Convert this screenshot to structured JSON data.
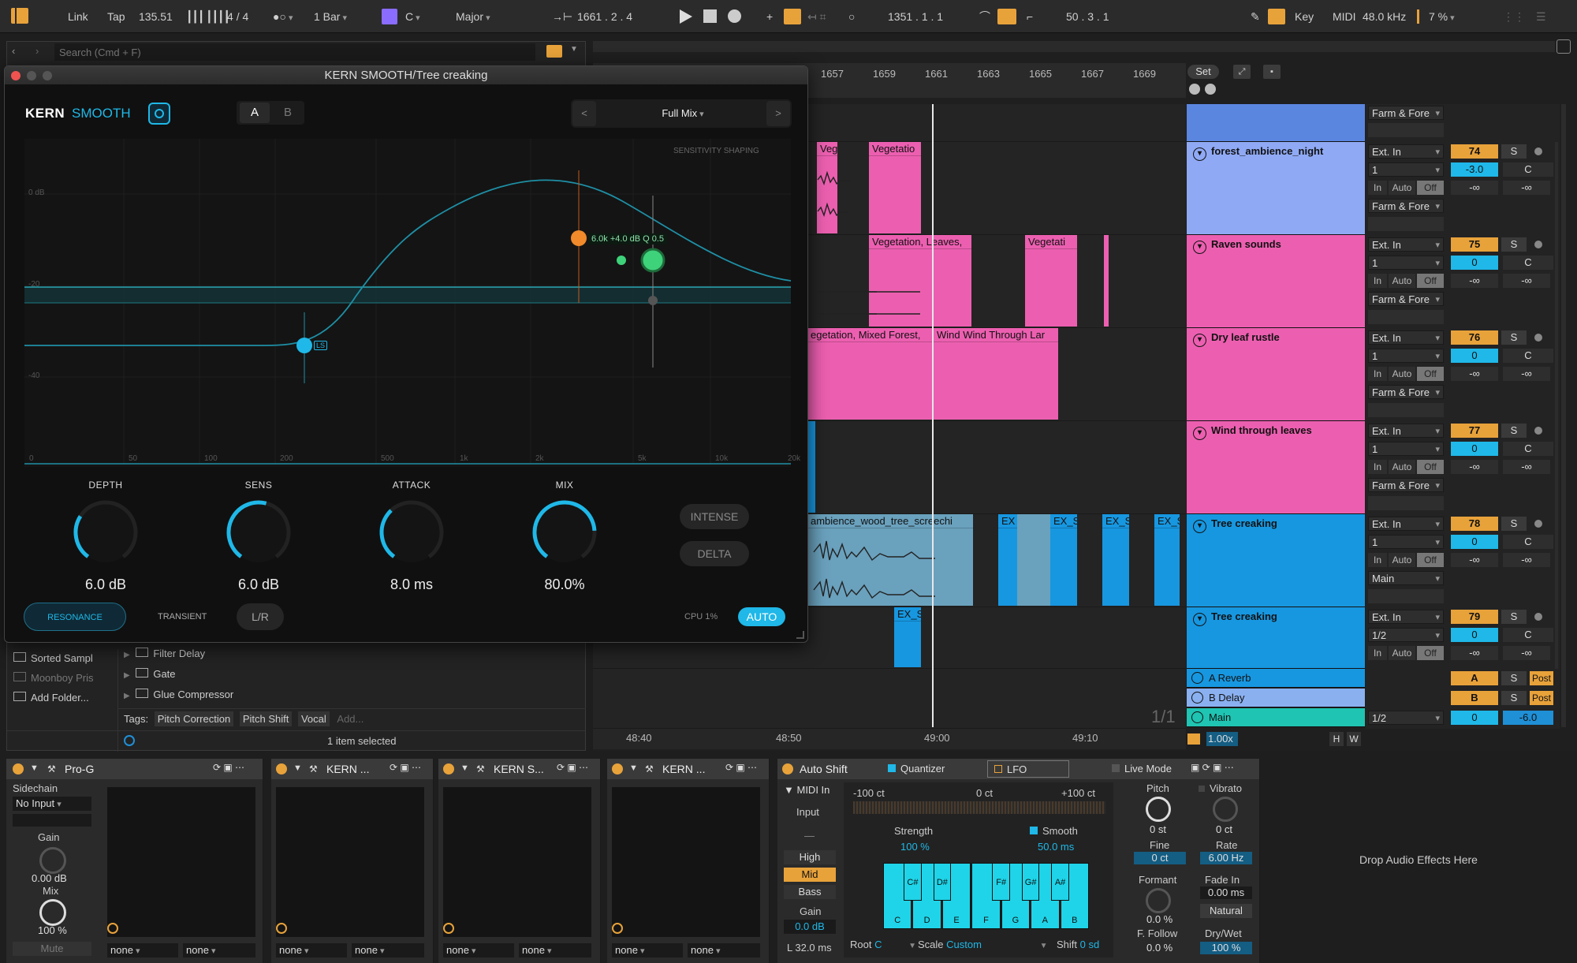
{
  "transport": {
    "link": "Link",
    "tap": "Tap",
    "tempo": "135.51",
    "sig_num": "4",
    "sig_slash": "/",
    "sig_den": "4",
    "quantize": "1 Bar",
    "key_root": "C",
    "key_scale": "Major",
    "position": "1661 .   2 .   4",
    "loop_start": "1351 .   1 .   1",
    "loop_len": "50 .   3 .   1",
    "key_btn": "Key",
    "midi_btn": "MIDI",
    "sample_rate": "48.0 kHz",
    "cpu": "7 %"
  },
  "browser": {
    "search_placeholder": "Search (Cmd + F)",
    "places": [
      "Sorted Sampl",
      "Moonboy Pris",
      "Add Folder..."
    ],
    "items": [
      "Filter Delay",
      "Gate",
      "Glue Compressor"
    ],
    "tags_label": "Tags:",
    "tags": [
      "Pitch Correction",
      "Pitch Shift",
      "Vocal",
      "Add..."
    ],
    "status": "1 item selected"
  },
  "plugin": {
    "window_title": "KERN SMOOTH/Tree creaking",
    "brand": "KERN",
    "product": "SMOOTH",
    "ab_a": "A",
    "ab_b": "B",
    "preset": "Full Mix",
    "graph_label": "SENSITIVITY SHAPING",
    "y_labels": [
      "0 dB",
      "-20",
      "-40"
    ],
    "x_labels": [
      "0",
      "50",
      "100",
      "200",
      "500",
      "1k",
      "2k",
      "5k",
      "10k",
      "20k"
    ],
    "node_readout": "6.0k  +4.0 dB  Q 0.5",
    "ls_tag": "LS",
    "knobs": [
      {
        "label": "DEPTH",
        "value": "6.0 dB",
        "fill": 0.3
      },
      {
        "label": "SENS",
        "value": "6.0 dB",
        "fill": 0.55
      },
      {
        "label": "ATTACK",
        "value": "8.0 ms",
        "fill": 0.35
      },
      {
        "label": "MIX",
        "value": "80.0%",
        "fill": 0.8
      }
    ],
    "intense": "INTENSE",
    "delta": "DELTA",
    "resonance": "RESONANCE",
    "transient": "TRANSIENT",
    "lr": "L/R",
    "cpu_label": "CPU",
    "cpu_value": "1%",
    "auto": "AUTO",
    "accent": "#1fb8e8"
  },
  "arrangement": {
    "ruler": [
      "1657",
      "1659",
      "1661",
      "1663",
      "1665",
      "1667",
      "1669"
    ],
    "set_btn": "Set",
    "time_ruler": [
      "48:40",
      "48:50",
      "49:00",
      "49:10"
    ],
    "page": "1/1",
    "zoom": "1.00x",
    "clips": {
      "veg1": "Veg",
      "veg2": "Vegetatio",
      "raven1": "Vegetation, Leaves,",
      "raven2": "Vegetati",
      "dry1": "egetation, Mixed Forest,",
      "dry2": "Wind Wind Through Lar",
      "tree1": "ambience_wood_tree_screechi",
      "ex1": "EX",
      "ex2": "EX_S",
      "ex3": "EX_S",
      "ex4": "EX_S",
      "ex5": "EX_S"
    }
  },
  "tracks": [
    {
      "name": "forest_ambience_night",
      "input": "Ext. In",
      "channel": "1",
      "num": "74",
      "vol": "-3.0",
      "pan": "C",
      "route": "Farm & Fore"
    },
    {
      "name": "Raven sounds",
      "input": "Ext. In",
      "channel": "1",
      "num": "75",
      "vol": "0",
      "pan": "C",
      "route": "Farm & Fore"
    },
    {
      "name": "Dry leaf rustle",
      "input": "Ext. In",
      "channel": "1",
      "num": "76",
      "vol": "0",
      "pan": "C",
      "route": "Farm & Fore"
    },
    {
      "name": "Wind through leaves",
      "input": "Ext. In",
      "channel": "1",
      "num": "77",
      "vol": "0",
      "pan": "C",
      "route": "Farm & Fore"
    },
    {
      "name": "Tree creaking",
      "input": "Ext. In",
      "channel": "1",
      "num": "78",
      "vol": "0",
      "pan": "C",
      "route": "Main"
    },
    {
      "name": "Tree creaking",
      "input": "Ext. In",
      "channel": "1/2",
      "num": "79",
      "vol": "0",
      "pan": "C",
      "route": ""
    }
  ],
  "track_labels": {
    "solo": "S",
    "in": "In",
    "auto": "Auto",
    "off": "Off",
    "neg_inf": "-∞",
    "farm_top": "Farm & Fore"
  },
  "returns": [
    {
      "name": "A Reverb",
      "letter": "A",
      "post": "Post"
    },
    {
      "name": "B Delay",
      "letter": "B",
      "post": "Post"
    },
    {
      "name": "Main",
      "route": "1/2",
      "vol": "0",
      "pan": "-6.0"
    }
  ],
  "hw": {
    "h": "H",
    "w": "W"
  },
  "devices": {
    "prog": {
      "title": "Pro-G",
      "sidechain": "Sidechain",
      "sc_input": "No Input",
      "gain_label": "Gain",
      "gain_val": "0.00 dB",
      "mix_label": "Mix",
      "mix_val": "100 %",
      "mute": "Mute"
    },
    "kern1": "KERN ...",
    "kern2": "KERN S...",
    "kern3": "KERN ...",
    "none": "none",
    "autoshift": {
      "title": "Auto Shift",
      "quantizer": "Quantizer",
      "lfo": "LFO",
      "live_mode": "Live Mode",
      "midi_in": "MIDI In",
      "input": "Input",
      "dash": "—",
      "high": "High",
      "mid": "Mid",
      "bass": "Bass",
      "gain_label": "Gain",
      "gain_val": "0.0 dB",
      "latency": "L 32.0 ms",
      "scale_left": "-100 ct",
      "scale_mid": "0 ct",
      "scale_right": "+100 ct",
      "strength_label": "Strength",
      "strength_val": "100 %",
      "smooth_label": "Smooth",
      "smooth_val": "50.0 ms",
      "white_keys": [
        "C",
        "D",
        "E",
        "F",
        "G",
        "A",
        "B"
      ],
      "black_keys": [
        "C#",
        "D#",
        "F#",
        "G#",
        "A#"
      ],
      "root_label": "Root",
      "root_val": "C",
      "scale_label": "Scale",
      "scale_val": "Custom",
      "shift_label": "Shift",
      "shift_val": "0 sd",
      "pitch_label": "Pitch",
      "pitch_val": "0 st",
      "fine_label": "Fine",
      "fine_val": "0 ct",
      "formant_label": "Formant",
      "formant_val": "0.0 %",
      "ffollow_label": "F. Follow",
      "ffollow_val": "0.0 %",
      "vibrato_label": "Vibrato",
      "vibrato_val": "0 ct",
      "rate_label": "Rate",
      "rate_val": "6.00 Hz",
      "fadein_label": "Fade In",
      "fadein_val": "0.00 ms",
      "natural": "Natural",
      "drywet_label": "Dry/Wet",
      "drywet_val": "100 %"
    },
    "drop_hint": "Drop Audio Effects Here"
  }
}
